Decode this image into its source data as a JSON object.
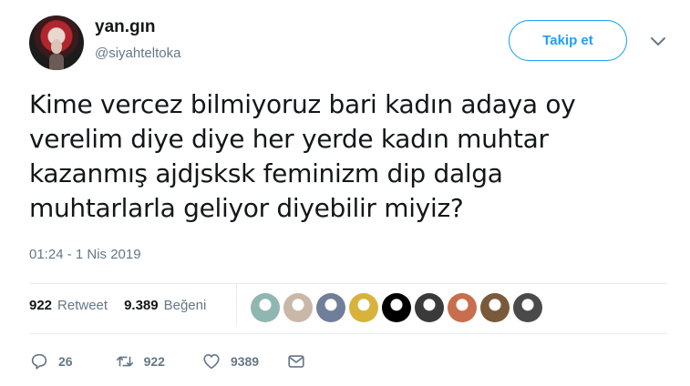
{
  "user": {
    "name": "yan.gın",
    "handle": "@siyahteltoka"
  },
  "follow_label": "Takip et",
  "tweet": {
    "text_lines": [
      "Kime vercez bilmiyoruz bari kadın adaya oy",
      "verelim diye diye her yerde kadın muhtar",
      "kazanmış ajdjsksk feminizm dip dalga",
      "muhtarlarla geliyor diyebilir miyiz?"
    ],
    "timestamp": "01:24 - 1 Nis 2019"
  },
  "stats": {
    "retweet_count": "922",
    "retweet_label": "Retweet",
    "like_count": "9.389",
    "like_label": "Beğeni"
  },
  "likers": [
    {
      "color": "#8fb6b0"
    },
    {
      "color": "#c9b7a8"
    },
    {
      "color": "#6f7f9a"
    },
    {
      "color": "#d8b23a"
    },
    {
      "color": "#000000"
    },
    {
      "color": "#3a3a3a"
    },
    {
      "color": "#c86e4c"
    },
    {
      "color": "#7a5a3a"
    },
    {
      "color": "#4a4a4a"
    }
  ],
  "actions": {
    "reply_count": "26",
    "retweet_count": "922",
    "like_count": "9389"
  },
  "colors": {
    "accent": "#1da1f2",
    "muted": "#657786",
    "text": "#14171a"
  }
}
